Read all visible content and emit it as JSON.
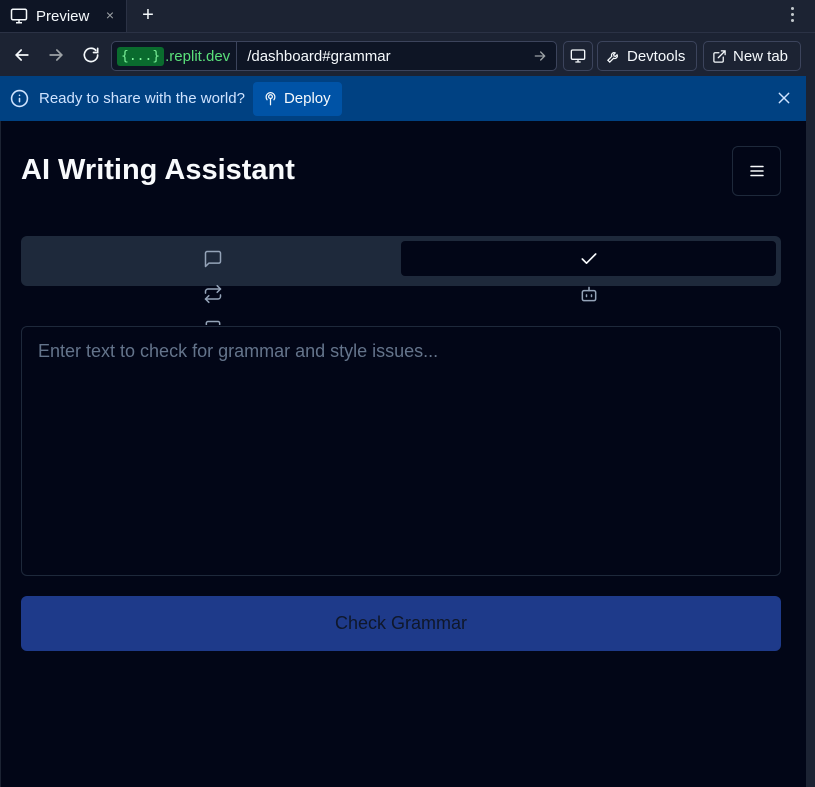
{
  "browser": {
    "tab": {
      "title": "Preview",
      "close": "×"
    },
    "new_tab": "+",
    "url": {
      "domain_tag": "{...}",
      "domain": ".replit.dev",
      "path": "/dashboard#grammar"
    },
    "buttons": {
      "devtools": "Devtools",
      "new_tab": "New tab"
    }
  },
  "banner": {
    "message": "Ready to share with the world?",
    "deploy_label": "Deploy"
  },
  "app": {
    "title": "AI Writing Assistant",
    "tabs": [
      {
        "icon": "message-square-icon",
        "active": false
      },
      {
        "icon": "check-icon",
        "active": true
      },
      {
        "icon": "repeat-icon",
        "active": false
      },
      {
        "icon": "bot-icon",
        "active": false
      },
      {
        "icon": "file-text-icon",
        "active": false
      }
    ],
    "editor": {
      "placeholder": "Enter text to check for grammar and style issues..."
    },
    "submit_label": "Check Grammar"
  },
  "colors": {
    "background": "#020617",
    "accent": "#1e3a8a",
    "banner": "#004182"
  }
}
